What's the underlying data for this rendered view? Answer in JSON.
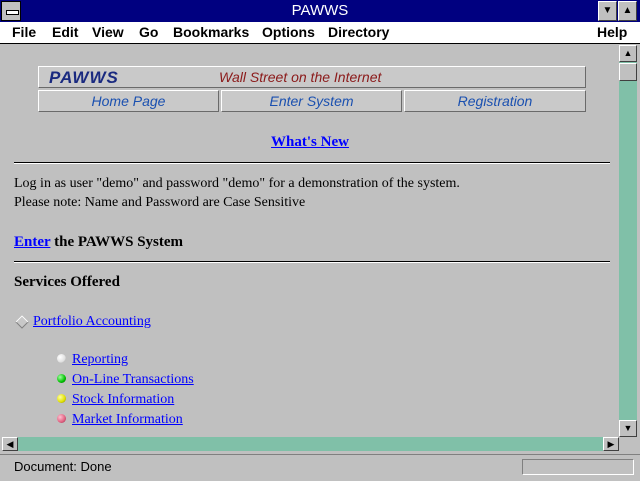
{
  "window": {
    "title": "PAWWS"
  },
  "menu": {
    "items": [
      "File",
      "Edit",
      "View",
      "Go",
      "Bookmarks",
      "Options",
      "Directory"
    ],
    "help": "Help"
  },
  "banner": {
    "logo": "PAWWS",
    "tagline": "Wall Street on the Internet",
    "nav": [
      "Home Page",
      "Enter System",
      "Registration"
    ]
  },
  "page": {
    "whats_new": "What's New",
    "login_line1": "Log in as user \"demo\" and password \"demo\" for a demonstration of the system.",
    "login_line2": "Please note: Name and Password are Case Sensitive",
    "enter_link": "Enter",
    "enter_rest": " the PAWWS System",
    "services_heading": "Services Offered",
    "portfolio_link": "Portfolio Accounting",
    "services": [
      {
        "label": "Reporting",
        "color": "#e0e0e0"
      },
      {
        "label": "On-Line Transactions",
        "color": "#00c000"
      },
      {
        "label": "Stock Information",
        "color": "#e0e000"
      },
      {
        "label": "Market Information",
        "color": "#e06080"
      }
    ]
  },
  "status": {
    "text": "Document: Done"
  }
}
